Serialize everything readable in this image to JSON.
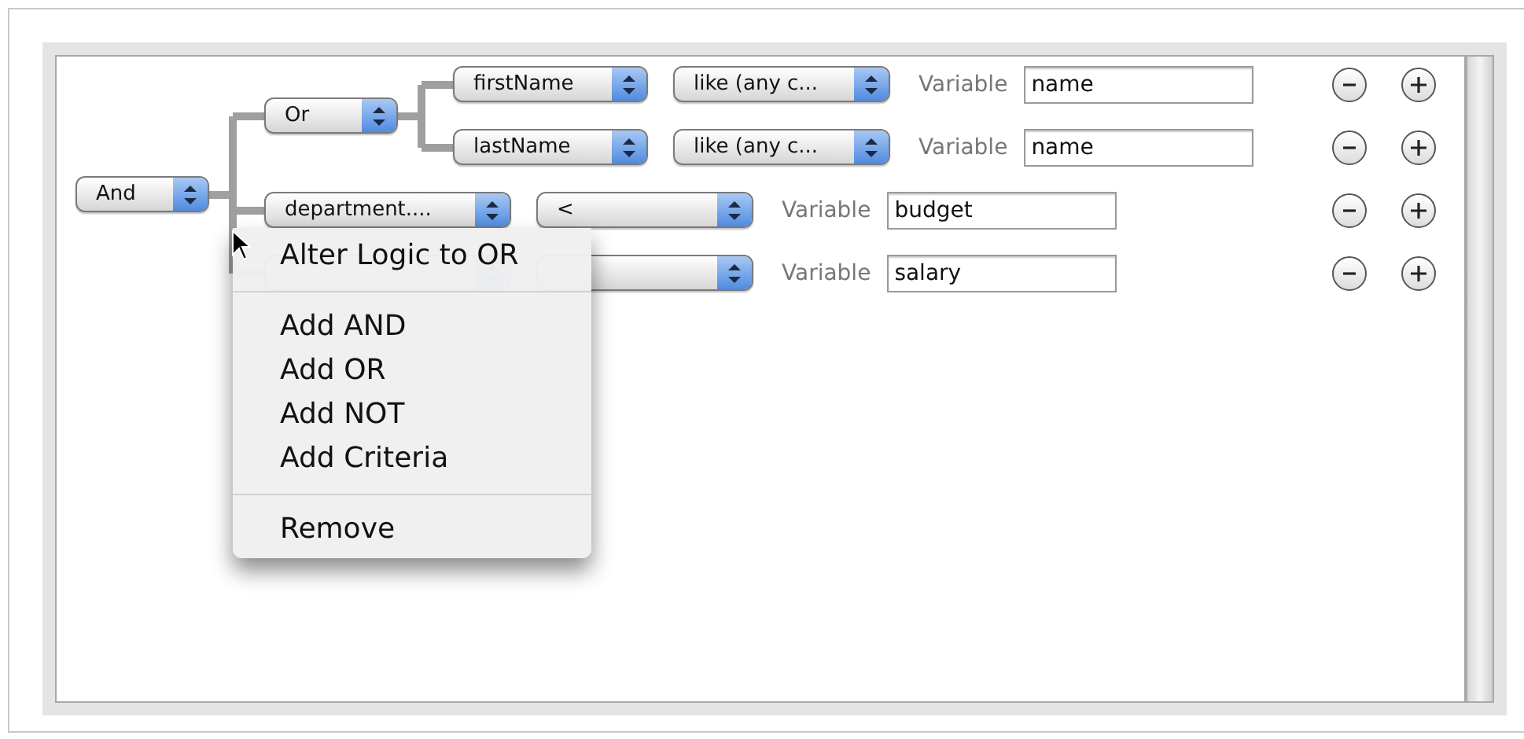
{
  "tree": {
    "label": "And",
    "children": [
      {
        "kind": "logic",
        "label": "Or",
        "children": [
          {
            "kind": "criteria",
            "field": "firstName",
            "operator": "like (any c...",
            "variable_label": "Variable",
            "value": "name"
          },
          {
            "kind": "criteria",
            "field": "lastName",
            "operator": "like (any c...",
            "variable_label": "Variable",
            "value": "name"
          }
        ]
      },
      {
        "kind": "criteria",
        "field": "department....",
        "operator": "<",
        "variable_label": "Variable",
        "value": "budget"
      },
      {
        "kind": "criteria",
        "variable_label": "Variable",
        "value": "salary"
      }
    ]
  },
  "context_menu": {
    "items": [
      {
        "kind": "item",
        "label": "Alter Logic to OR"
      },
      {
        "kind": "separator"
      },
      {
        "kind": "item",
        "label": "Add AND"
      },
      {
        "kind": "item",
        "label": "Add OR"
      },
      {
        "kind": "item",
        "label": "Add NOT"
      },
      {
        "kind": "item",
        "label": "Add Criteria"
      },
      {
        "kind": "separator"
      },
      {
        "kind": "item",
        "label": "Remove"
      }
    ]
  }
}
